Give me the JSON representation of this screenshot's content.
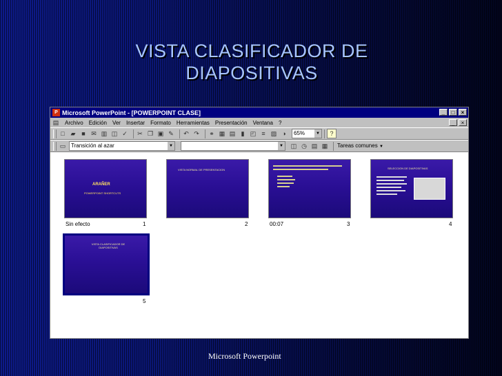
{
  "title": "VISTA CLASIFICADOR DE DIAPOSITIVAS",
  "footer": "Microsoft Powerpoint",
  "window": {
    "title": "Microsoft PowerPoint - [POWERPOINT CLASE]",
    "app_icon": "P",
    "buttons": [
      "_",
      "□",
      "×"
    ],
    "doc_buttons": [
      "_",
      "×"
    ]
  },
  "menu": [
    "Archivo",
    "Edición",
    "Ver",
    "Insertar",
    "Formato",
    "Herramientas",
    "Presentación",
    "Ventana",
    "?"
  ],
  "toolbar": {
    "zoom": "65%",
    "help": "?"
  },
  "toolbar2": {
    "transition": "Transición al azar",
    "effect": "",
    "tasks": "Tareas comunes"
  },
  "slides": [
    {
      "num": "1",
      "time": "Sin efecto",
      "title": "ARAÑER",
      "subtitle": "POWERPOINT SHORTCUTS",
      "footer": ""
    },
    {
      "num": "2",
      "time": "",
      "title": "VISTA NORMAL DE PRESENTACION",
      "subtitle": "",
      "footer": ""
    },
    {
      "num": "3",
      "time": "00:07",
      "title": "",
      "subtitle": "",
      "footer": ""
    },
    {
      "num": "4",
      "time": "",
      "title": "SELECCION DE DIAPOSITIVAS",
      "subtitle": "",
      "footer": ""
    },
    {
      "num": "5",
      "time": "",
      "title": "VISTA CLASIFICADOR DE DIAPOSITIVAS",
      "subtitle": "",
      "footer": ""
    }
  ],
  "colors": {
    "background": "#0a1675",
    "title_text": "#a8c6ff",
    "slide_fill": "#2a0f95",
    "titlebar": "#000080"
  }
}
